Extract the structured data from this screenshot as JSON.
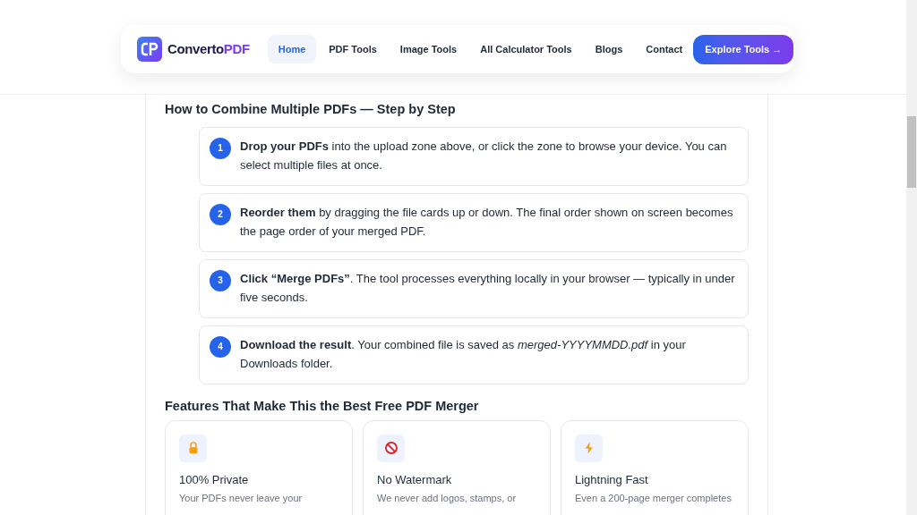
{
  "nav": {
    "logo": {
      "text": "Converto",
      "accent": "PDF"
    },
    "links": [
      {
        "label": "Home",
        "selected": true
      },
      {
        "label": "PDF Tools",
        "selected": false
      },
      {
        "label": "Image Tools",
        "selected": false
      },
      {
        "label": "All Calculator Tools",
        "selected": false
      },
      {
        "label": "Blogs",
        "selected": false
      },
      {
        "label": "Contact",
        "selected": false
      }
    ],
    "cta": "Explore Tools →"
  },
  "steps_section": {
    "title": "How to Combine Multiple PDFs — Step by Step",
    "steps": [
      {
        "number": "1",
        "text": "**Drop your PDFs** into the upload zone above, or click the zone to browse your device. You can select multiple files at once."
      },
      {
        "number": "2",
        "text": "**Reorder them** by dragging the file cards up or down. The final order shown on screen becomes the page order of your merged PDF."
      },
      {
        "number": "3",
        "text": "**Click “Merge PDFs”**. The tool processes everything locally in your browser — typically in under five seconds."
      },
      {
        "number": "4",
        "text": "**Download the result**. Your combined file is saved as *merged-YYYYMMDD.pdf* in your Downloads folder."
      }
    ]
  },
  "features_section": {
    "title": "Features That Make This the Best Free PDF Merger",
    "features": [
      {
        "kind": "lock",
        "title": "100% Private",
        "text": "Your PDFs never leave your"
      },
      {
        "kind": "forbidden",
        "title": "No Watermark",
        "text": "We never add logos, stamps, or"
      },
      {
        "kind": "bolt",
        "title": "Lightning Fast",
        "text": "Even a 200-page merger completes"
      }
    ]
  }
}
